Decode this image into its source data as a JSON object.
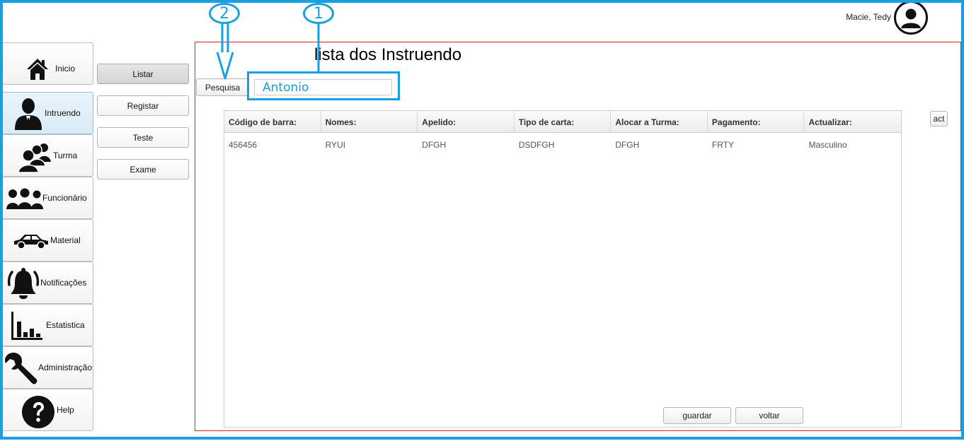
{
  "header": {
    "user_name": "Macie, Tedy",
    "avatar_icon": "user-avatar-icon"
  },
  "nav": {
    "items": [
      {
        "label": "Inicio",
        "icon": "home-icon"
      },
      {
        "label": "Intruendo",
        "icon": "student-icon"
      },
      {
        "label": "Turma",
        "icon": "group-icon"
      },
      {
        "label": "Funcionário",
        "icon": "staff-icon"
      },
      {
        "label": "Material",
        "icon": "car-icon"
      },
      {
        "label": "Notificações",
        "icon": "bell-icon"
      },
      {
        "label": "Estatistica",
        "icon": "bar-chart-icon"
      },
      {
        "label": "Administração",
        "icon": "wrench-icon"
      },
      {
        "label": "Help",
        "icon": "help-icon"
      }
    ],
    "active": "Intruendo"
  },
  "subnav": {
    "items": [
      {
        "label": "Listar"
      },
      {
        "label": "Registar"
      },
      {
        "label": "Teste"
      },
      {
        "label": "Exame"
      }
    ],
    "active": "Listar"
  },
  "main": {
    "title": "lista dos Instruendo",
    "search_button": "Pesquisa",
    "search_value": "Antonio",
    "act_button": "act",
    "table": {
      "columns": [
        "Código de barra:",
        "Nomes:",
        "Apelido:",
        "Tipo de carta:",
        "Alocar a Turma:",
        "Pagamento:",
        "Actualizar:"
      ],
      "rows": [
        [
          "456456",
          "RYUI",
          "DFGH",
          "DSDFGH",
          "DFGH",
          "FRTY",
          "Masculino"
        ]
      ]
    },
    "save_button": "guardar",
    "back_button": "voltar"
  },
  "annotations": {
    "step_1": "1",
    "step_2": "2",
    "color": "#1aa0e0"
  }
}
